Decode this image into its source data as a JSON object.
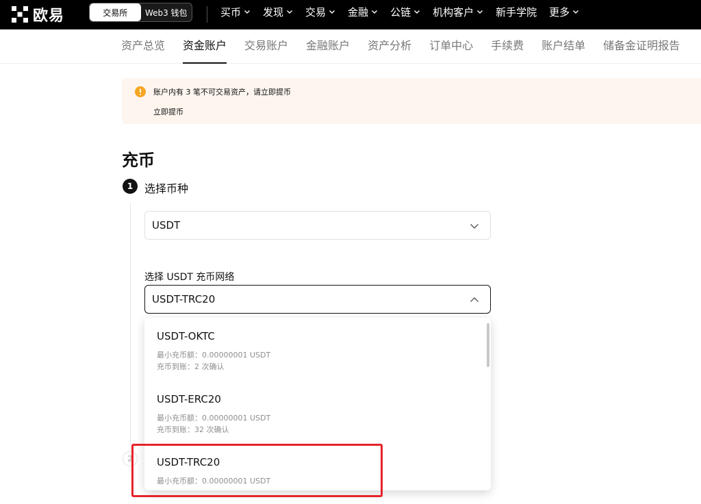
{
  "brand": {
    "name": "欧易"
  },
  "mode_toggle": {
    "exchange": "交易所",
    "web3": "Web3 钱包"
  },
  "topnav": [
    {
      "label": "买币",
      "dropdown": true
    },
    {
      "label": "发现",
      "dropdown": true
    },
    {
      "label": "交易",
      "dropdown": true
    },
    {
      "label": "金融",
      "dropdown": true
    },
    {
      "label": "公链",
      "dropdown": true
    },
    {
      "label": "机构客户",
      "dropdown": true
    },
    {
      "label": "新手学院",
      "dropdown": false
    },
    {
      "label": "更多",
      "dropdown": true
    }
  ],
  "subnav": [
    "资产总览",
    "资金账户",
    "交易账户",
    "金融账户",
    "资产分析",
    "订单中心",
    "手续费",
    "账户结单",
    "储备金证明报告"
  ],
  "subnav_active": "资金账户",
  "banner": {
    "message": "账户内有 3 笔不可交易资产，请立即提币",
    "link": "立即提币"
  },
  "page_title": "充币",
  "step1": {
    "number": "1",
    "label": "选择币种"
  },
  "step2": {
    "number": "2"
  },
  "coin_select": {
    "value": "USDT"
  },
  "network": {
    "label": "选择 USDT 充币网络",
    "value": "USDT-TRC20",
    "options": [
      {
        "name": "USDT-OKTC",
        "min": "最小充币额：0.00000001 USDT",
        "confirm": "充币到账：2 次确认"
      },
      {
        "name": "USDT-ERC20",
        "min": "最小充币额：0.00000001 USDT",
        "confirm": "充币到账：32 次确认"
      },
      {
        "name": "USDT-TRC20",
        "min": "最小充币额：0.00000001 USDT",
        "confirm": ""
      }
    ]
  },
  "colors": {
    "highlight": "#e6232a",
    "banner_bg": "#fdf5ee",
    "warning": "#f5a623"
  }
}
